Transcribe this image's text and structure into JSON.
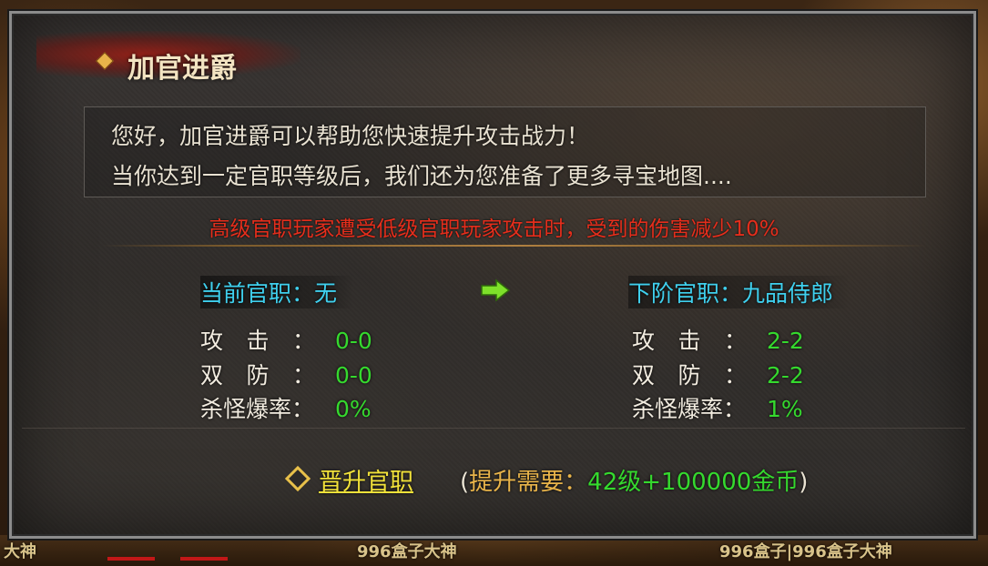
{
  "panel": {
    "title": "加官进爵",
    "intro_line1": "您好，加官进爵可以帮助您快速提升攻击战力！",
    "intro_line2": "当你达到一定官职等级后，我们还为您准备了更多寻宝地图....",
    "note": "高级官职玩家遭受低级官职玩家攻击时，受到的伤害减少10%"
  },
  "current": {
    "heading": "当前官职：无",
    "stats": [
      {
        "label": "攻击：",
        "value": "0-0"
      },
      {
        "label": "双防：",
        "value": "0-0"
      },
      {
        "label": "杀怪爆率：",
        "value": "0%"
      }
    ]
  },
  "next": {
    "heading": "下阶官职：九品侍郎",
    "stats": [
      {
        "label": "攻击：",
        "value": "2-2"
      },
      {
        "label": "双防：",
        "value": "2-2"
      },
      {
        "label": "杀怪爆率：",
        "value": "1%"
      }
    ]
  },
  "action": {
    "promote_label": "晋升官职",
    "req_open": "(",
    "req_label": "提升需要：",
    "req_value": "42级+100000金币",
    "req_close": ")"
  },
  "background": {
    "strip_labels": [
      "大神",
      "996盒子大神",
      "996盒子|996盒子大神"
    ]
  },
  "colors": {
    "heading_cyan": "#3fd0ee",
    "value_green": "#35d92e",
    "warning_red": "#e52e1c",
    "link_yellow": "#f2e23a",
    "panel_border": "#8c8c8c"
  },
  "icons": {
    "title_marker": "diamond-icon",
    "arrow": "arrow-right-icon",
    "promote_marker": "diamond-outline-icon"
  }
}
